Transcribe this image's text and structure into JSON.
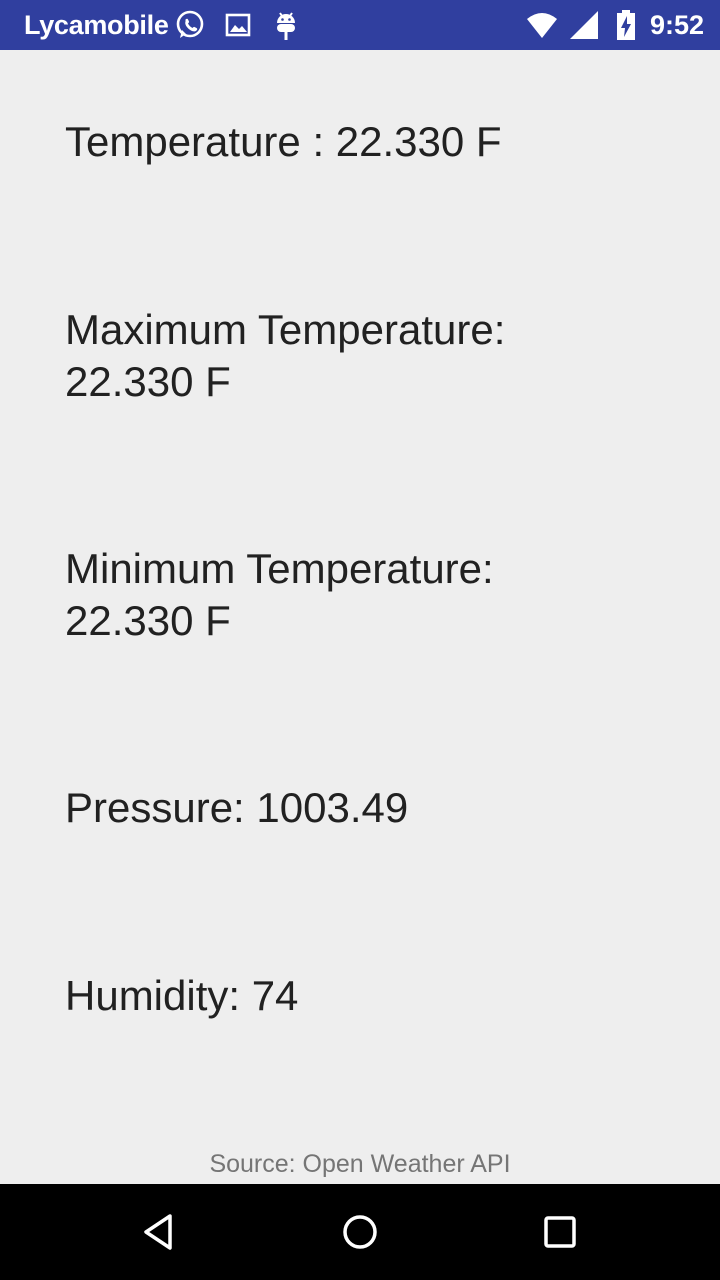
{
  "status_bar": {
    "carrier": "Lycamobile",
    "time": "9:52",
    "icons": [
      "whatsapp-icon",
      "image-icon",
      "android-debug-icon",
      "wifi-icon",
      "cell-signal-icon",
      "battery-charging-icon"
    ]
  },
  "weather": {
    "temperature": "Temperature : 22.330 F",
    "max_temperature_label": "Maximum Temperature:",
    "max_temperature_value": "22.330 F",
    "min_temperature_label": "Minimum Temperature:",
    "min_temperature_value": "22.330 F",
    "pressure": "Pressure: 1003.49",
    "humidity": "Humidity: 74"
  },
  "footer": {
    "source": "Source: Open Weather API"
  },
  "nav_bar": {
    "icons": [
      "back-icon",
      "home-icon",
      "recents-icon"
    ]
  },
  "colors": {
    "status_bar": "#303f9f",
    "background": "#eeeeee",
    "text": "#212121",
    "source_text": "#757575",
    "nav_bar": "#000000"
  }
}
